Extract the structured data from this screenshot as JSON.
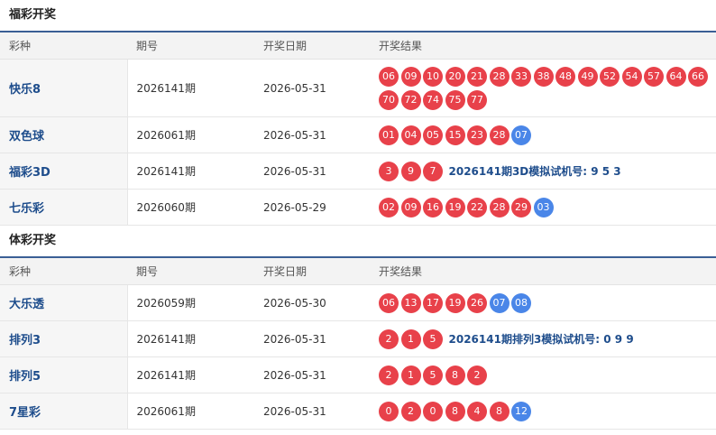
{
  "colors": {
    "red_ball": "#e8414a",
    "blue_ball": "#4a86e8",
    "name_text": "#1e4d8c",
    "header_rule": "#3a5f95"
  },
  "headers": [
    "彩种",
    "期号",
    "开奖日期",
    "开奖结果"
  ],
  "sections": [
    {
      "title": "福彩开奖",
      "rows": [
        {
          "name": "快乐8",
          "issue": "2026141期",
          "date": "2026-05-31",
          "red": [
            "06",
            "09",
            "10",
            "20",
            "21",
            "28",
            "33",
            "38",
            "48",
            "49",
            "52",
            "54",
            "57",
            "64",
            "66",
            "70",
            "72",
            "74",
            "75",
            "77"
          ],
          "blue": [],
          "sim": ""
        },
        {
          "name": "双色球",
          "issue": "2026061期",
          "date": "2026-05-31",
          "red": [
            "01",
            "04",
            "05",
            "15",
            "23",
            "28"
          ],
          "blue": [
            "07"
          ],
          "sim": ""
        },
        {
          "name": "福彩3D",
          "issue": "2026141期",
          "date": "2026-05-31",
          "red": [
            "3",
            "9",
            "7"
          ],
          "blue": [],
          "sim": "2026141期3D模拟试机号: 9 5 3"
        },
        {
          "name": "七乐彩",
          "issue": "2026060期",
          "date": "2026-05-29",
          "red": [
            "02",
            "09",
            "16",
            "19",
            "22",
            "28",
            "29"
          ],
          "blue": [
            "03"
          ],
          "sim": ""
        }
      ]
    },
    {
      "title": "体彩开奖",
      "rows": [
        {
          "name": "大乐透",
          "issue": "2026059期",
          "date": "2026-05-30",
          "red": [
            "06",
            "13",
            "17",
            "19",
            "26"
          ],
          "blue": [
            "07",
            "08"
          ],
          "sim": ""
        },
        {
          "name": "排列3",
          "issue": "2026141期",
          "date": "2026-05-31",
          "red": [
            "2",
            "1",
            "5"
          ],
          "blue": [],
          "sim": "2026141期排列3模拟试机号: 0 9 9"
        },
        {
          "name": "排列5",
          "issue": "2026141期",
          "date": "2026-05-31",
          "red": [
            "2",
            "1",
            "5",
            "8",
            "2"
          ],
          "blue": [],
          "sim": ""
        },
        {
          "name": "7星彩",
          "issue": "2026061期",
          "date": "2026-05-31",
          "red": [
            "0",
            "2",
            "0",
            "8",
            "4",
            "8"
          ],
          "blue": [
            "12"
          ],
          "sim": ""
        }
      ]
    }
  ]
}
